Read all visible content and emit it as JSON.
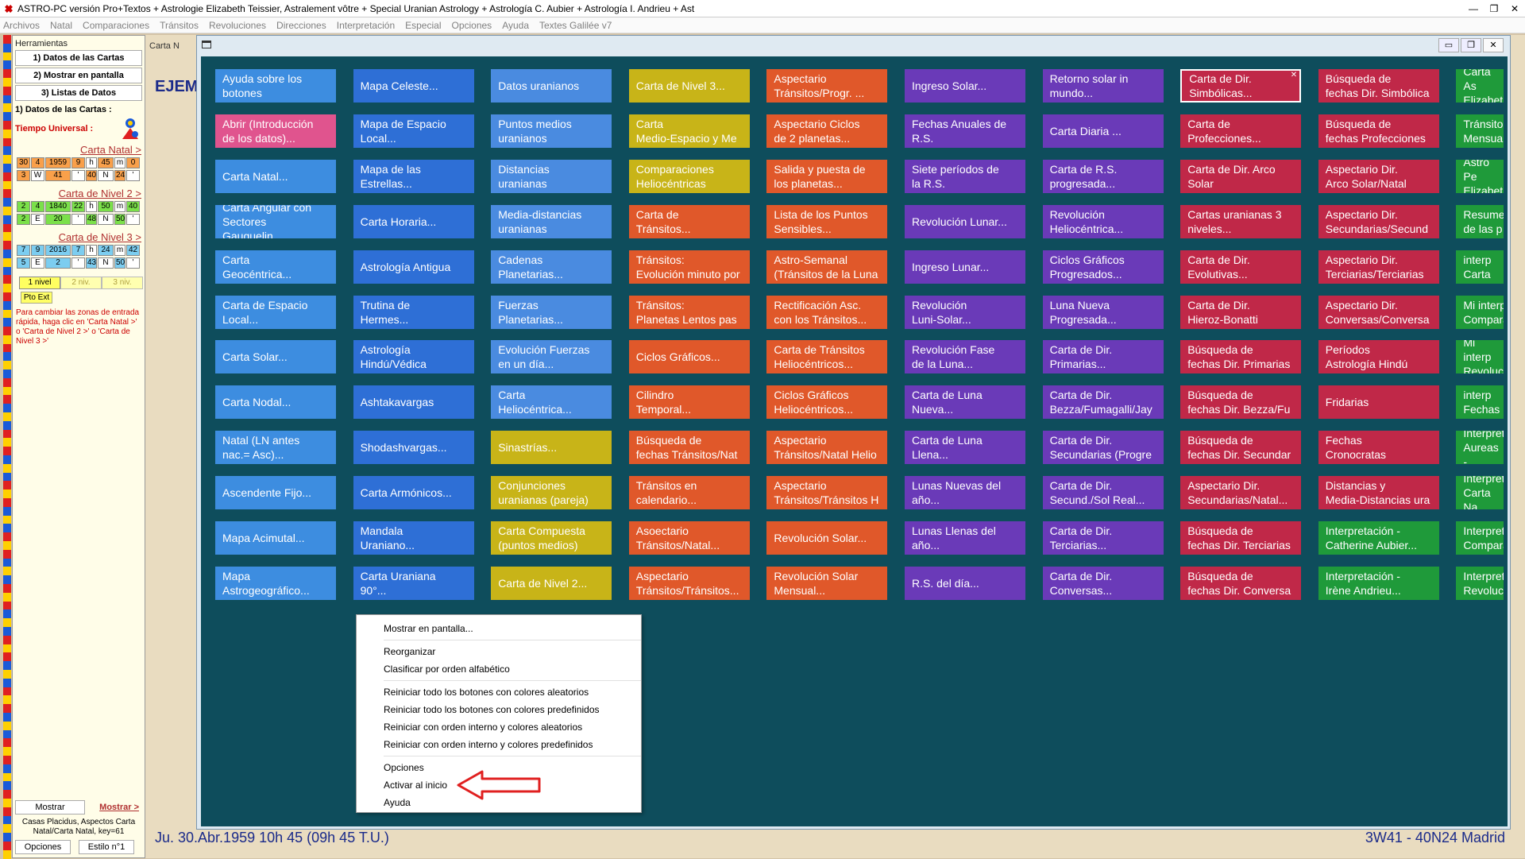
{
  "window": {
    "title": "ASTRO-PC versión Pro+Textos + Astrologie Elizabeth Teissier, Astralement vôtre + Special Uranian Astrology + Astrología C. Aubier + Astrología I. Andrieu + Ast",
    "controls": {
      "minimize": "—",
      "restore": "❐",
      "close": "✕"
    }
  },
  "menu": [
    "Archivos",
    "Natal",
    "Comparaciones",
    "Tránsitos",
    "Revoluciones",
    "Direcciones",
    "Interpretación",
    "Especial",
    "Opciones",
    "Ayuda",
    "Textes Galilée v7"
  ],
  "sidebar": {
    "header": "Herramientas",
    "buttons": [
      "1) Datos de las Cartas",
      "2) Mostrar en pantalla",
      "3) Listas de Datos"
    ],
    "subtitle": "1) Datos de las Cartas :",
    "tu_label": "Tiempo Universal :",
    "carta_natal_link": "Carta Natal >",
    "natal_row1": [
      "30",
      "4",
      "1959",
      "9",
      "h",
      "45",
      "m",
      "0"
    ],
    "natal_row2": [
      "3",
      "W",
      "41",
      "'",
      "40",
      "N",
      "24",
      "'"
    ],
    "nivel2_link": "Carta de Nivel 2 >",
    "nivel2_row1": [
      "2",
      "4",
      "1840",
      "22",
      "h",
      "50",
      "m",
      "40"
    ],
    "nivel2_row2": [
      "2",
      "E",
      "20",
      "'",
      "48",
      "N",
      "50",
      "'"
    ],
    "nivel3_link": "Carta de Nivel 3 >",
    "nivel3_row1": [
      "7",
      "9",
      "2016",
      "7",
      "h",
      "24",
      "m",
      "42"
    ],
    "nivel3_row2": [
      "5",
      "E",
      "2",
      "'",
      "43",
      "N",
      "50",
      "'"
    ],
    "niveles": [
      "1 nivel",
      "2 niv.",
      "3 niv."
    ],
    "pto_ext": "Pto Ext",
    "note": "Para cambiar las zonas de entrada rápida, haga clic en 'Carta Natal >' o 'Carta de Nivel 2 >' o 'Carta de Nivel 3 >'",
    "mostrar_btn": "Mostrar",
    "mostrar_link": "Mostrar >",
    "casas": "Casas Placidus, Aspectos Carta Natal/Carta Natal, key=61",
    "opciones": "Opciones",
    "estilo": "Estilo n°1"
  },
  "background_window": {
    "tab_label": "Carta N",
    "heading": "EJEM",
    "status_left": "Ju. 30.Abr.1959 10h 45 (09h 45 T.U.)",
    "status_right": "3W41 - 40N24  Madrid"
  },
  "popup": {
    "controls": {
      "minimize": "▭",
      "restore": "❐",
      "close": "✕"
    },
    "colors": {
      "sky": "#3d8de0",
      "blue": "#2e6fd6",
      "steel": "#4a8be0",
      "gold": "#c8b418",
      "orange": "#e0582a",
      "violet": "#6a3ab8",
      "crimson": "#c02848",
      "green": "#1f9a3a",
      "pink": "#e0548e"
    },
    "columns": [
      {
        "color": "#3d8de0",
        "tiles": [
          "Ayuda sobre los\nbotones",
          "Abrir (Introducción\nde los datos)...",
          "Carta Natal...",
          "Carta Angular con\nSectores Gauquelin...",
          "Carta\nGeocéntrica...",
          "Carta de Espacio\nLocal...",
          "Carta Solar...",
          "Carta Nodal...",
          "Natal (LN antes\nnac.= Asc)...",
          "Ascendente Fijo...",
          "Mapa Acimutal...",
          "Mapa\nAstrogeográfico..."
        ]
      },
      {
        "color": "#2e6fd6",
        "tiles": [
          "Mapa Celeste...",
          "Mapa de Espacio\nLocal...",
          "Mapa de las\nEstrellas...",
          "Carta Horaria...",
          "Astrología Antigua",
          "Trutina de\nHermes...",
          "Astrología\nHindú/Védica",
          "Ashtakavargas",
          "Shodashvargas...",
          "Carta Armónicos...",
          "Mandala\nUraniano...",
          "Carta Uraniana\n90°..."
        ]
      },
      {
        "color": "#4a8be0",
        "tiles": [
          "Datos uranianos",
          "Puntos medios\nuranianos",
          "Distancias\nuranianas",
          "Media-distancias\nuranianas",
          "Cadenas\nPlanetarias...",
          "Fuerzas\nPlanetarias...",
          "Evolución Fuerzas\nen un día...",
          "Carta\nHeliocéntrica...",
          "Sinastrías...",
          "Conjunciones\nuranianas (pareja)",
          "Carta Compuesta\n(puntos medios)",
          "Carta de Nivel 2..."
        ]
      },
      {
        "color": "#e0582a",
        "tiles": [
          "Carta de Nivel 3...",
          "Carta\nMedio-Espacio y Me",
          "Comparaciones\nHeliocéntricas",
          "Carta de\nTránsitos...",
          "Tránsitos:\nEvolución minuto por",
          "Tránsitos:\nPlanetas Lentos pas",
          "Ciclos Gráficos...",
          "Cilindro\nTemporal...",
          "Búsqueda de\nfechas Tránsitos/Nat",
          "Tránsitos en\ncalendario...",
          "Asoectario\nTránsitos/Natal...",
          "Aspectario\nTránsitos/Tránsitos..."
        ]
      },
      {
        "color": "#e0582a",
        "tiles": [
          "Aspectario\nTránsitos/Progr. ...",
          "Aspectario Ciclos\nde 2 planetas...",
          "Salida y puesta de\nlos planetas...",
          "Lista de los Puntos\nSensibles...",
          "Astro-Semanal\n(Tránsitos de la Luna",
          "Rectificación Asc.\ncon los Tránsitos...",
          "Carta de Tránsitos\nHeliocéntricos...",
          "Ciclos Gráficos\nHeliocéntricos...",
          "Aspectario\nTránsitos/Natal Helio",
          "Aspectario\nTránsitos/Tránsitos H",
          "Revolución Solar...",
          "Revolución Solar\nMensual..."
        ]
      },
      {
        "color": "#6a3ab8",
        "tiles": [
          "Ingreso Solar...",
          "Fechas Anuales de\nR.S.",
          "Siete períodos de\nla R.S.",
          "Revolución Lunar...",
          "Ingreso Lunar...",
          "Revolución\nLuni-Solar...",
          "Revolución Fase\nde la Luna...",
          "Carta de Luna\nNueva...",
          "Carta de Luna\nLlena...",
          "Lunas Nuevas del\naño...",
          "Lunas Llenas del\naño...",
          "R.S. del día..."
        ]
      },
      {
        "color": "#6a3ab8",
        "tiles": [
          "Retorno solar in\nmundo...",
          "Carta Diaria ...",
          "Carta de R.S.\nprogresada...",
          "Revolución\nHeliocéntrica...",
          "Ciclos Gráficos\nProgresados...",
          "Luna Nueva\nProgresada...",
          "Carta de Dir.\nPrimarias...",
          "Carta de Dir.\nBezza/Fumagalli/Jay",
          "Carta de Dir.\nSecundarias (Progre",
          "Carta de Dir.\nSecund./Sol Real...",
          "Carta de Dir.\nTerciarias...",
          "Carta de Dir.\nConversas..."
        ]
      },
      {
        "color": "#c02848",
        "tiles": [
          "Carta de Dir.\nSimbólicas...",
          "Carta de\nProfecciones...",
          "Carta de Dir. Arco\nSolar",
          "Cartas uranianas 3\nniveles...",
          "Carta de Dir.\nEvolutivas...",
          "Carta de Dir.\nHieroz-Bonatti",
          "Búsqueda de\nfechas Dir. Primarias",
          "Búsqueda de\nfechas Dir. Bezza/Fu",
          "Búsqueda de\nfechas Dir. Secundar",
          "Aspectario Dir.\nSecundarias/Natal...",
          "Búsqueda de\nfechas Dir. Terciarias",
          "Búsqueda de\nfechas Dir. Conversa"
        ]
      },
      {
        "color": "#c02848",
        "tiles": [
          "Búsqueda de\nfechas Dir. Simbólica",
          "Búsqueda de\nfechas Profecciones",
          "Aspectario Dir.\nArco Solar/Natal",
          "Aspectario Dir.\nSecundarias/Secund",
          "Aspectario Dir.\nTerciarias/Terciarias",
          "Aspectario Dir.\nConversas/Conversa",
          "Períodos\nAstrología Hindú",
          "Fridarias",
          "Fechas\nCronocratas",
          "Distancias y\nMedia-Distancias ura",
          "Interpretación -\nCatherine Aubier...",
          "Interpretación -\nIrène Andrieu..."
        ]
      },
      {
        "color": "#1f9a3a",
        "tiles": [
          "Carta As\nElizabet",
          "Tránsito\nMensual",
          "Astro Pe\nElizabet",
          "Resume\nde las p",
          "Mi interp\nCarta Na",
          "Mi interp\nCompara",
          "Mi interp\nRevoluc",
          "Mi interp\nFechas c",
          "Interpret\nAureas -",
          "Interpret\nCarta Na",
          "Interpret\nCompara",
          "Interpret\nRevoluc"
        ]
      }
    ],
    "context_menu": {
      "groups": [
        [
          "Mostrar en pantalla..."
        ],
        [
          "Reorganizar",
          "Clasificar por orden alfabético"
        ],
        [
          "Reiniciar todo los botones con colores aleatorios",
          "Reiniciar todo los botones con colores predefinidos",
          "Reiniciar con orden interno y colores aleatorios",
          "Reiniciar con orden interno y colores predefinidos"
        ],
        [
          "Opciones",
          "Activar al inicio",
          "Ayuda"
        ]
      ],
      "highlight_color": "#e02020"
    }
  }
}
